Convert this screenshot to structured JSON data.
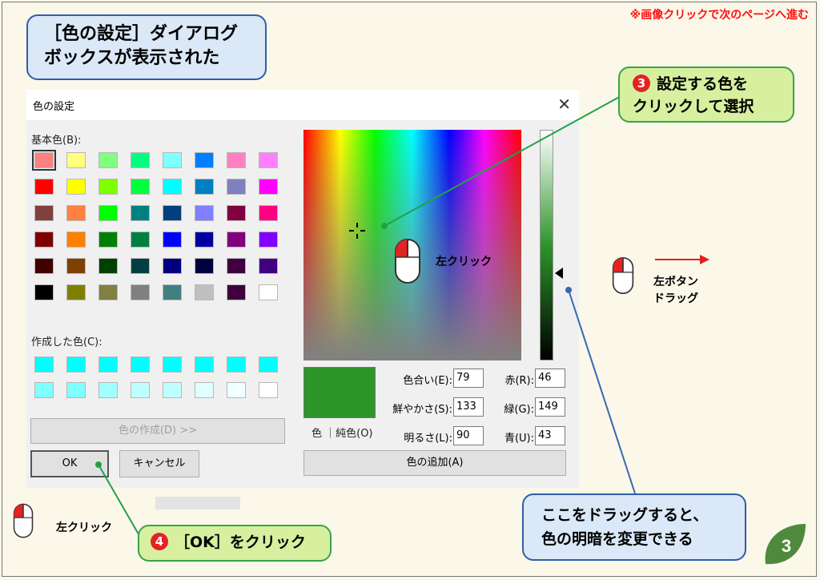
{
  "nav_note": "※画像クリックで次のページへ進む",
  "callouts": {
    "dialog_shown_line1": "［色の設定］ダイアログ",
    "dialog_shown_line2": "ボックスが表示された",
    "step3_num": "❸",
    "step3_line1": "設定する色を",
    "step3_line2": "クリックして選択",
    "step4_text": "［OK］をクリック",
    "drag_line1": "ここをドラッグすると、",
    "drag_line2": "色の明暗を変更できる"
  },
  "mouse_labels": {
    "left_click_spectrum": "左クリック",
    "left_click_ok": "左クリック",
    "left_drag_line1": "左ボタン",
    "left_drag_line2": "ドラッグ"
  },
  "dialog": {
    "title": "色の設定",
    "basic_colors_label": "基本色(B):",
    "custom_colors_label": "作成した色(C):",
    "define_custom_button": "色の作成(D) >>",
    "ok_button": "OK",
    "cancel_button": "キャンセル",
    "add_custom_button": "色の追加(A)",
    "color_solid_label": "色 ｜純色(O)",
    "hue_label": "色合い(E):",
    "hue_value": "79",
    "sat_label": "鮮やかさ(S):",
    "sat_value": "133",
    "lum_label": "明るさ(L):",
    "lum_value": "90",
    "red_label": "赤(R):",
    "red_value": "46",
    "green_label": "緑(G):",
    "green_value": "149",
    "blue_label": "青(U):",
    "blue_value": "43",
    "basic_colors": [
      [
        "#ff8080",
        "#ffff80",
        "#80ff80",
        "#00ff80",
        "#80ffff",
        "#0080ff",
        "#ff80c0",
        "#ff80ff"
      ],
      [
        "#ff0000",
        "#ffff00",
        "#80ff00",
        "#00ff40",
        "#00ffff",
        "#0080c0",
        "#8080c0",
        "#ff00ff"
      ],
      [
        "#804040",
        "#ff8040",
        "#00ff00",
        "#008080",
        "#004080",
        "#8080ff",
        "#800040",
        "#ff0080"
      ],
      [
        "#800000",
        "#ff8000",
        "#008000",
        "#008040",
        "#0000ff",
        "#0000a0",
        "#800080",
        "#8000ff"
      ],
      [
        "#400000",
        "#804000",
        "#004000",
        "#004040",
        "#000080",
        "#000040",
        "#400040",
        "#400080"
      ],
      [
        "#000000",
        "#808000",
        "#808040",
        "#808080",
        "#408080",
        "#c0c0c0",
        "#400040",
        "#ffffff"
      ]
    ],
    "custom_colors": [
      [
        "#00ffff",
        "#00ffff",
        "#00ffff",
        "#00ffff",
        "#00ffff",
        "#00ffff",
        "#00ffff",
        "#00ffff"
      ],
      [
        "#80ffff",
        "#80ffff",
        "#a0ffff",
        "#c0ffff",
        "#c0ffff",
        "#e0ffff",
        "#f0ffff",
        "#ffffff"
      ]
    ],
    "selected_color": "#2e952b"
  },
  "page_number": "3",
  "colors": {
    "accent_red": "#ff1010",
    "callout_blue_border": "#2e5fa8",
    "callout_green_border": "#3aa24a",
    "leaf_green": "#4f8a3c"
  }
}
